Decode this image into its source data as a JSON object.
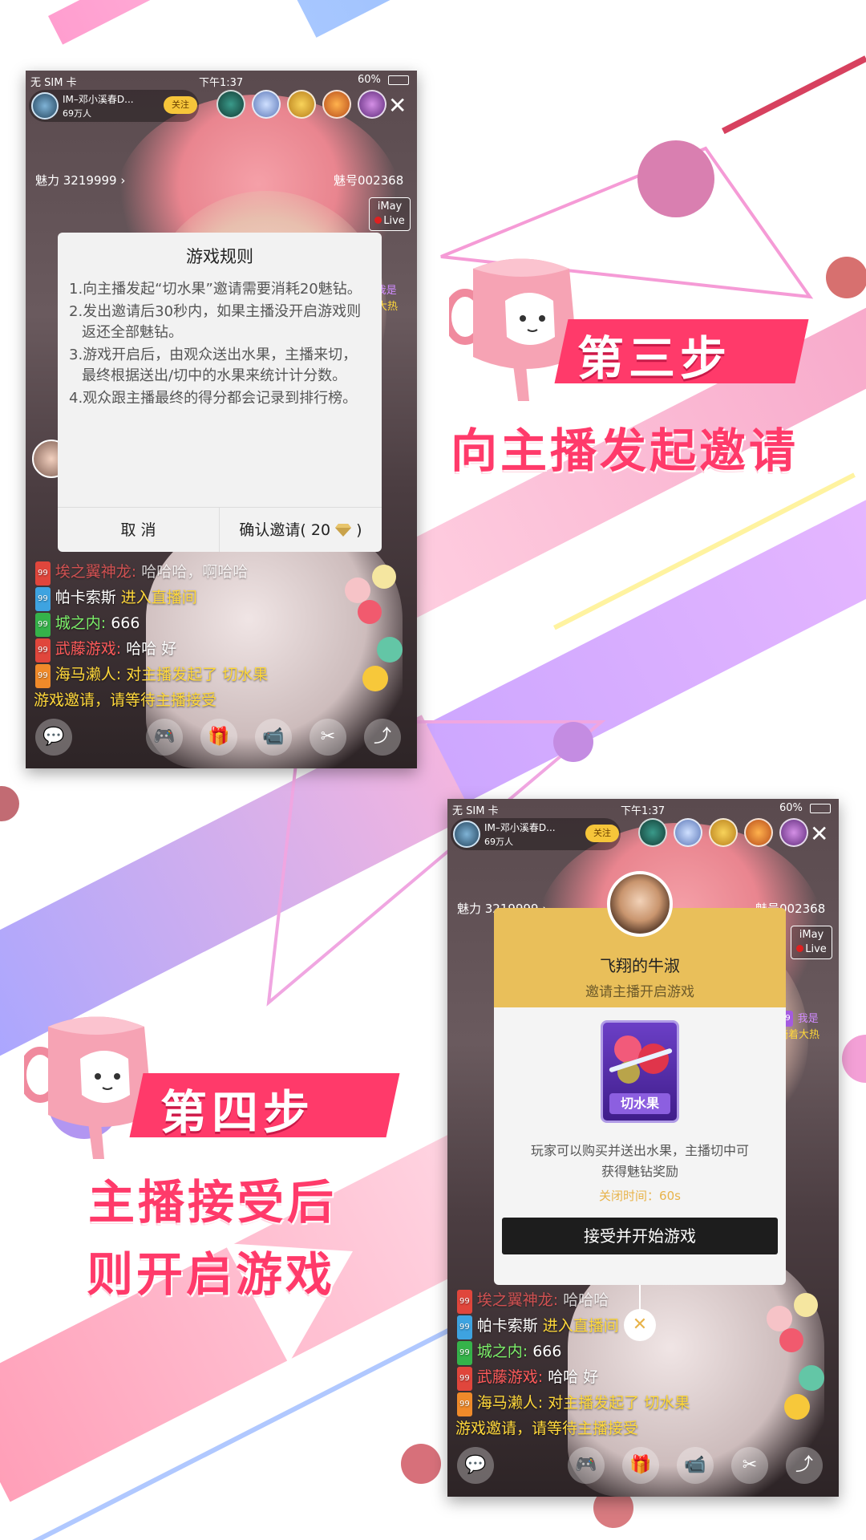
{
  "phone1": {
    "status": {
      "carrier": "无 SIM 卡",
      "time": "下午1:37",
      "battery": "60%"
    },
    "host": {
      "name": "IM–邓小溪春D...",
      "fans": "69万人",
      "follow_label": "关注"
    },
    "charm": "魅力 3219999",
    "room_no": "魅号002368",
    "badge": {
      "top": "iMay",
      "bottom": "Live"
    },
    "side_msg": {
      "level": "99",
      "name": "我是",
      "text": "骑着大热"
    },
    "modal": {
      "title": "游戏规则",
      "rules": [
        "1.向主播发起“切水果”邀请需要消耗20魅钻。",
        "2.发出邀请后30秒内，如果主播没开启游戏则返还全部魅钻。",
        "3.游戏开启后，由观众送出水果，主播来切，最终根据送出/切中的水果来统计计分数。",
        "4.观众跟主播最终的得分都会记录到排行榜。"
      ],
      "cancel_label": "取  消",
      "confirm_label": "确认邀请( 20",
      "confirm_suffix": ")"
    },
    "chat": [
      {
        "level": "99",
        "user": "埃之翼神龙:",
        "text": "哈哈哈，啊哈哈",
        "user_color": "#ff5a5a",
        "text_color": "#ffffff"
      },
      {
        "level": "99",
        "user": "帕卡索斯",
        "text": "进入直播间",
        "user_color": "#ffffff",
        "text_color": "#ffd83a"
      },
      {
        "level": "99",
        "user": "城之内:",
        "text": "666",
        "user_color": "#7cf06a",
        "text_color": "#ffffff"
      },
      {
        "level": "99",
        "user": "武藤游戏:",
        "text": "哈哈 好",
        "user_color": "#ff5a5a",
        "text_color": "#ffffff"
      },
      {
        "level": "99",
        "user": "海马濑人:",
        "text": "对主播发起了 切水果",
        "user_color": "#ffd83a",
        "text_color": "#ffd83a"
      }
    ],
    "chat_tail": "游戏邀请，请等待主播接受"
  },
  "step3": {
    "title": "第三步",
    "subtitle": "向主播发起邀请"
  },
  "step4": {
    "title": "第四步",
    "subtitle_line1": "主播接受后",
    "subtitle_line2": "则开启游戏"
  },
  "phone2": {
    "status": {
      "carrier": "无 SIM 卡",
      "time": "下午1:37",
      "battery": "60%"
    },
    "host": {
      "name": "IM–邓小溪春D...",
      "fans": "69万人",
      "follow_label": "关注"
    },
    "charm": "魅力 3219999",
    "room_no": "魅号002368",
    "badge": {
      "top": "iMay",
      "bottom": "Live"
    },
    "side_msg": {
      "level": "99",
      "name": "我是",
      "text": "骑着大热"
    },
    "invite": {
      "user_name": "飞翔的牛淑",
      "subtitle": "邀请主播开启游戏",
      "game_label": "切水果",
      "desc_line1": "玩家可以购买并送出水果，主播切中可",
      "desc_line2": "获得魅钻奖励",
      "close_time": "关闭时间：60s",
      "accept_label": "接受并开始游戏"
    },
    "chat": [
      {
        "level": "99",
        "user": "埃之翼神龙:",
        "text": "哈哈哈",
        "user_color": "#ff5a5a",
        "text_color": "#ffffff"
      },
      {
        "level": "99",
        "user": "帕卡索斯",
        "text": "进入直播间",
        "user_color": "#ffffff",
        "text_color": "#ffd83a"
      },
      {
        "level": "99",
        "user": "城之内:",
        "text": "666",
        "user_color": "#7cf06a",
        "text_color": "#ffffff"
      },
      {
        "level": "99",
        "user": "武藤游戏:",
        "text": "哈哈 好",
        "user_color": "#ff5a5a",
        "text_color": "#ffffff"
      },
      {
        "level": "99",
        "user": "海马濑人:",
        "text": "对主播发起了 切水果",
        "user_color": "#ffd83a",
        "text_color": "#ffd83a"
      }
    ],
    "chat_tail": "游戏邀请，请等待主播接受"
  },
  "icons": [
    "chat-icon",
    "gamepad-icon",
    "gift-icon",
    "camera-icon",
    "scissors-icon",
    "share-icon",
    "close-icon",
    "diamond-icon"
  ],
  "colors": {
    "accent_pink": "#ff3a6a",
    "gold": "#e9bf5a",
    "follow_yellow": "#f6c53a"
  }
}
